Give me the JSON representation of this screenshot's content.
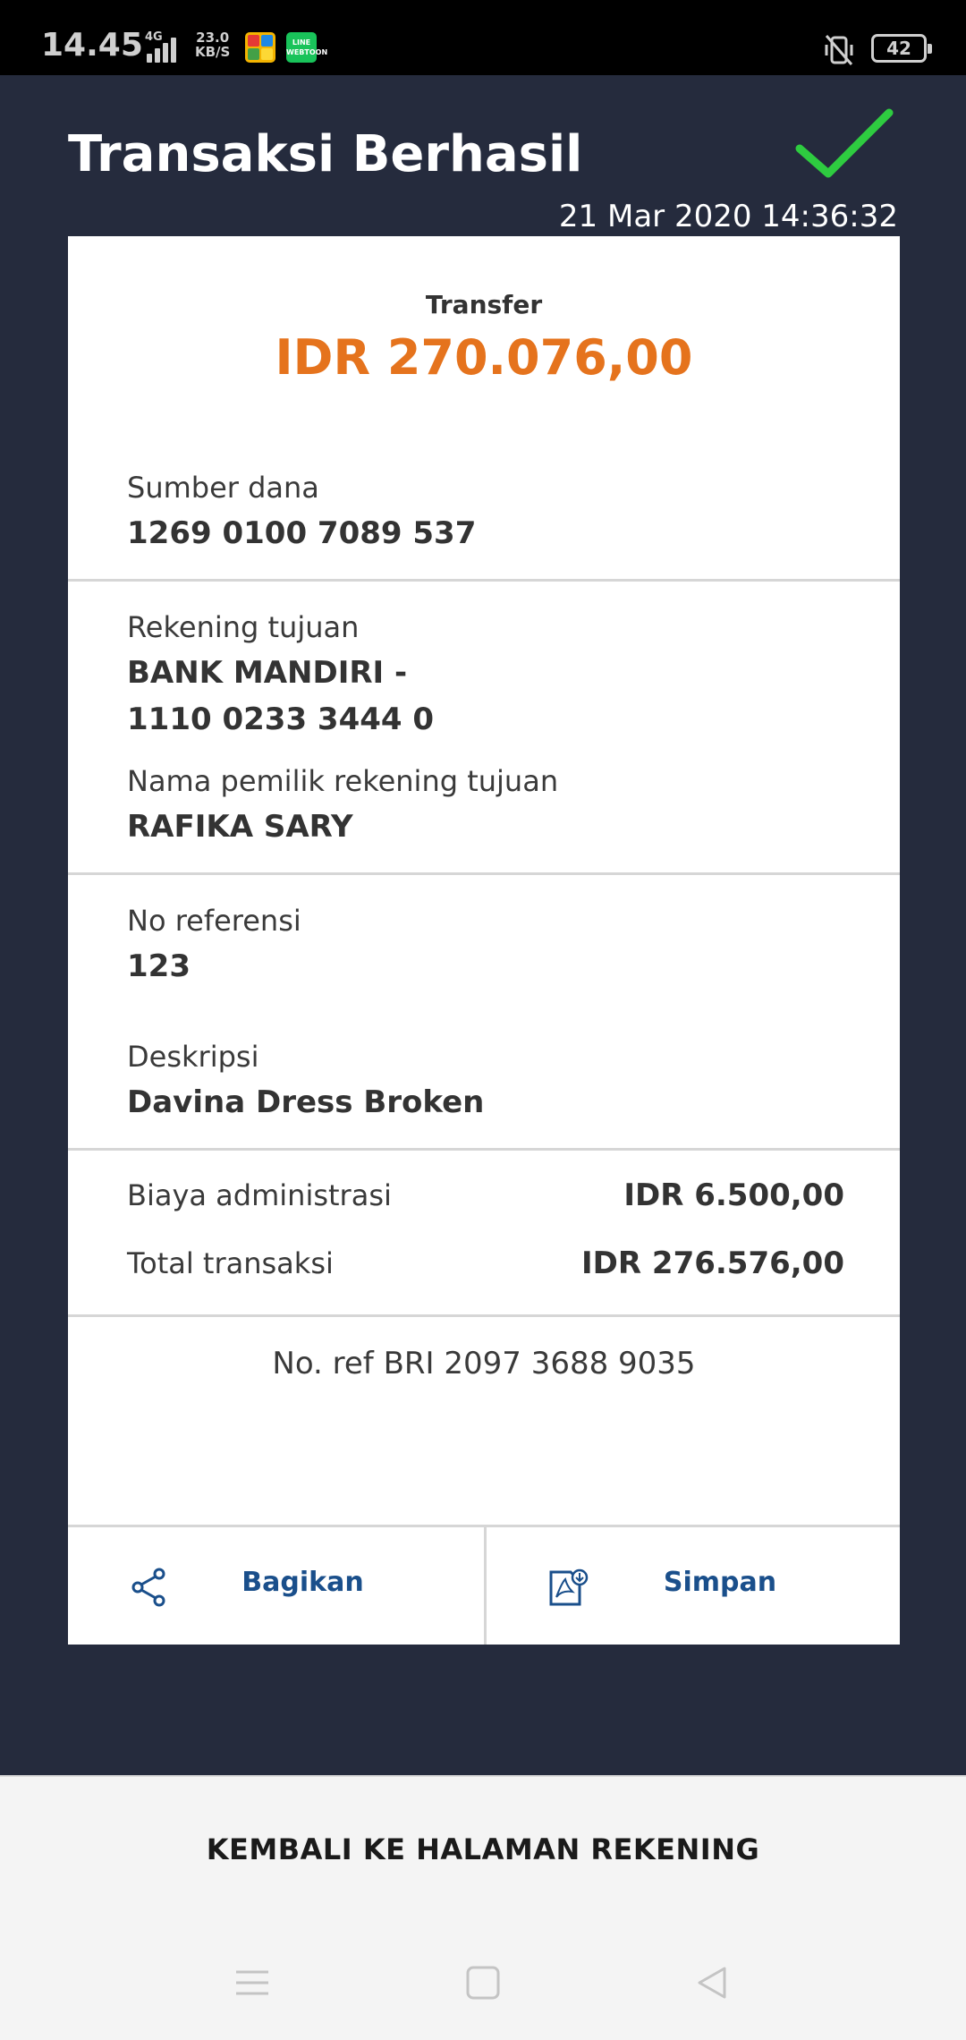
{
  "status_bar": {
    "time": "14.45",
    "network": "4G",
    "speed_value": "23.0",
    "speed_unit": "KB/S",
    "app2_label": "LINE WEBTOON",
    "battery": "42"
  },
  "header": {
    "title": "Transaksi Berhasil",
    "timestamp": "21 Mar 2020 14:36:32"
  },
  "receipt": {
    "type_label": "Transfer",
    "amount": "IDR 270.076,00",
    "source_label": "Sumber dana",
    "source_value": "1269 0100 7089 537",
    "dest_label": "Rekening tujuan",
    "dest_bank": "BANK MANDIRI -",
    "dest_account": "1110 0233 3444 0",
    "owner_label": "Nama pemilik rekening tujuan",
    "owner_value": "RAFIKA SARY",
    "ref_label": "No referensi",
    "ref_value": "123",
    "desc_label": "Deskripsi",
    "desc_value": "Davina Dress Broken",
    "fee_label": "Biaya administrasi",
    "fee_value": "IDR 6.500,00",
    "total_label": "Total transaksi",
    "total_value": "IDR 276.576,00",
    "bri_ref": "No. ref BRI 2097 3688 9035"
  },
  "actions": {
    "share_label": "Bagikan",
    "save_label": "Simpan"
  },
  "footer": {
    "back_label": "KEMBALI KE HALAMAN REKENING"
  },
  "colors": {
    "background": "#252b3d",
    "amount": "#e5731d",
    "action": "#1a4f8b",
    "success_check": "#2ecc40"
  },
  "icons": [
    "check-icon",
    "share-icon",
    "pdf-download-icon",
    "menu-nav-icon",
    "home-nav-icon",
    "back-nav-icon",
    "mute-icon"
  ]
}
